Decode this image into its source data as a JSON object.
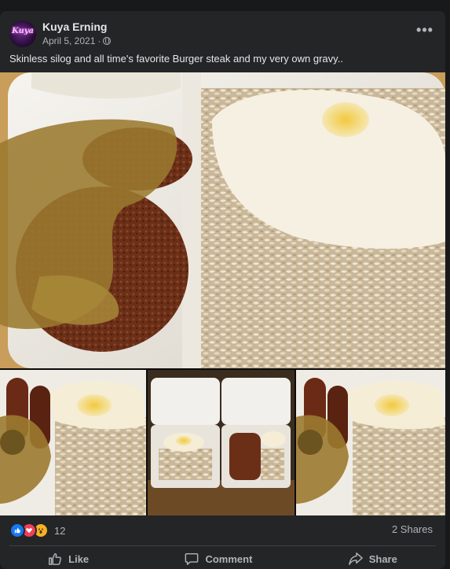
{
  "post": {
    "author": "Kuya Erning",
    "avatar_text": "Kuya",
    "date": "April 5, 2021",
    "separator": "·",
    "privacy_icon": "globe-icon",
    "more_icon": "more-horizontal-icon",
    "more_label": "•••",
    "caption": "Skinless silog and all time's favorite Burger steak and my very own gravy.."
  },
  "media": {
    "main_photo": "photo: burger steak with gravy, fried egg and garlic rice in foam box",
    "thumbnails": [
      "photo: skinless longganisa with gravy, egg and rice",
      "photo: two foam boxes with silog meals",
      "photo: skinless longganisa with gravy, egg and rice"
    ]
  },
  "stats": {
    "reaction_icons": [
      "like-icon",
      "love-icon",
      "wow-icon"
    ],
    "reaction_count": "12",
    "shares": "2 Shares"
  },
  "actions": {
    "like": "Like",
    "comment": "Comment",
    "share": "Share"
  },
  "colors": {
    "background": "#18191a",
    "card": "#242526",
    "primary_text": "#e4e6eb",
    "secondary_text": "#b0b3b8",
    "like_blue": "#1877f2",
    "love_red": "#f33e58",
    "wow_yellow": "#f7b125"
  }
}
